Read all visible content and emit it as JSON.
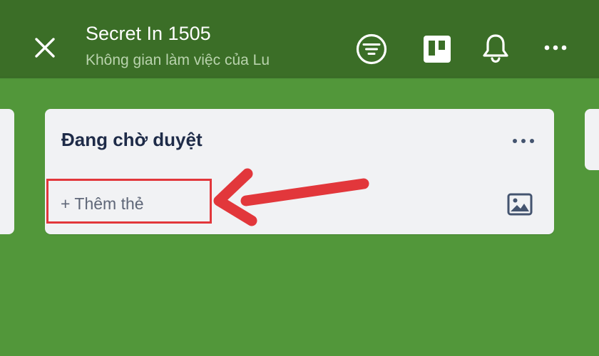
{
  "header": {
    "title": "Secret In 1505",
    "subtitle": "Không gian làm việc của Lu",
    "icons": {
      "close": "close-icon",
      "filter": "filter-icon",
      "board_view": "board-view-icon",
      "notifications": "bell-icon",
      "more": "more-horizontal-icon"
    }
  },
  "list": {
    "title": "Đang chờ duyệt",
    "add_card_label": "+ Thêm thẻ",
    "more_icon": "more-horizontal-icon",
    "template_icon": "image-icon"
  },
  "annotation": {
    "color": "#e2373b"
  },
  "colors": {
    "header_bg": "#3b6e27",
    "board_bg": "#52973a",
    "list_bg": "#f1f2f4",
    "list_title": "#1e2b48",
    "add_card_text": "#5f6778"
  }
}
